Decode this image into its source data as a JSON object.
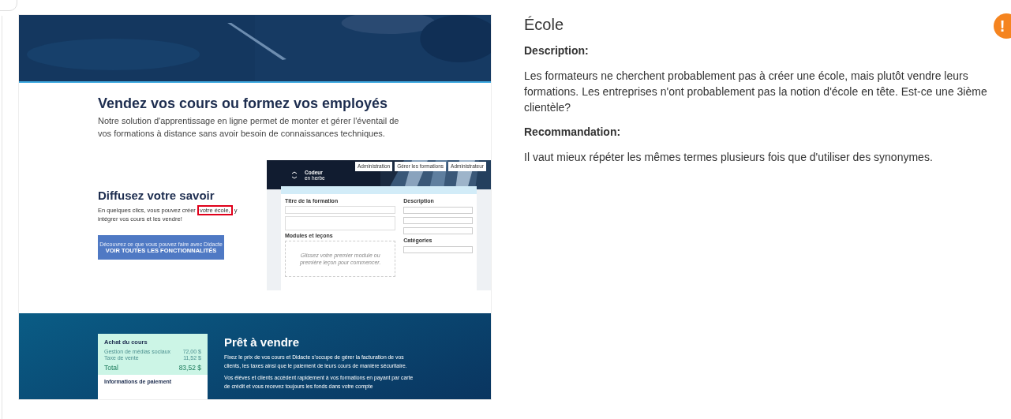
{
  "screenshot": {
    "intro": {
      "heading": "Vendez vos cours ou formez vos employés",
      "text": "Notre solution d'apprentissage en ligne permet de monter et gérer l'éventail de vos formations à distance sans avoir besoin de connaissances techniques."
    },
    "feature": {
      "heading": "Diffusez votre savoir",
      "text_before": "En quelques clics, vous pouvez créer ",
      "highlight": "votre école,",
      "text_after": " y intégrer vos cours et les vendre!",
      "button": {
        "subtitle": "Découvrez ce que vous pouvez faire avec Didacte",
        "label": "VOIR TOUTES LES FONCTIONNALITÉS"
      }
    },
    "app_preview": {
      "brand": "Codeur",
      "brand_sub": "en herbe",
      "nav": [
        "Administration",
        "Gérer les formations",
        "Administrateur"
      ],
      "title_label": "Titre de la formation",
      "modules_label": "Modules et leçons",
      "dropzone": "Glissez votre premier module ou première leçon pour commencer.",
      "side_heading": "Description",
      "categories_heading": "Catégories"
    },
    "sale": {
      "receipt": {
        "title": "Achat du cours",
        "lines": [
          {
            "label": "Gestion de médias sociaux",
            "amount": "72,00 $"
          },
          {
            "label": "Taxe de vente",
            "amount": "11,52 $"
          }
        ],
        "total_label": "Total",
        "total": "83,52 $",
        "payment_title": "Informations de paiement"
      },
      "heading": "Prêt à vendre",
      "paragraphs": [
        "Fixez le prix de vos cours et Didacte s'occupe de gérer la facturation de vos clients, les taxes ainsi que le paiement de leurs cours de manière sécuritaire.",
        "Vos élèves et clients accèdent rapidement à vos formations en payant par carte de crédit et vous recevez toujours les fonds dans votre compte"
      ]
    }
  },
  "annotation": {
    "title": "École",
    "sections": [
      {
        "heading": "Description:",
        "text": "Les formateurs ne cherchent probablement pas à créer une école, mais plutôt vendre leurs formations. Les entreprises n'ont probablement pas la notion d'école en tête. Est-ce une 3ième clientèle?"
      },
      {
        "heading": "Recommandation:",
        "text": "Il vaut mieux répéter les mêmes termes plusieurs fois que d'utiliser des synonymes."
      }
    ]
  },
  "alert_badge": {
    "symbol": "!"
  }
}
